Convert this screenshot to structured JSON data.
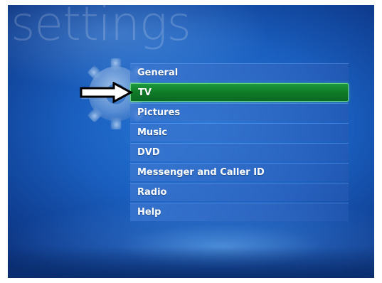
{
  "screen": {
    "background_title": "settings"
  },
  "menu": {
    "selected_index": 1,
    "items": [
      {
        "label": "General"
      },
      {
        "label": "TV"
      },
      {
        "label": "Pictures"
      },
      {
        "label": "Music"
      },
      {
        "label": "DVD"
      },
      {
        "label": "Messenger and Caller ID"
      },
      {
        "label": "Radio"
      },
      {
        "label": "Help"
      }
    ]
  },
  "icons": {
    "gear": "gear-icon",
    "pointer": "right-arrow-icon"
  },
  "colors": {
    "background": "#1a5fbf",
    "selected_item": "#0f7a28",
    "menu_item": "#3c78d2"
  }
}
